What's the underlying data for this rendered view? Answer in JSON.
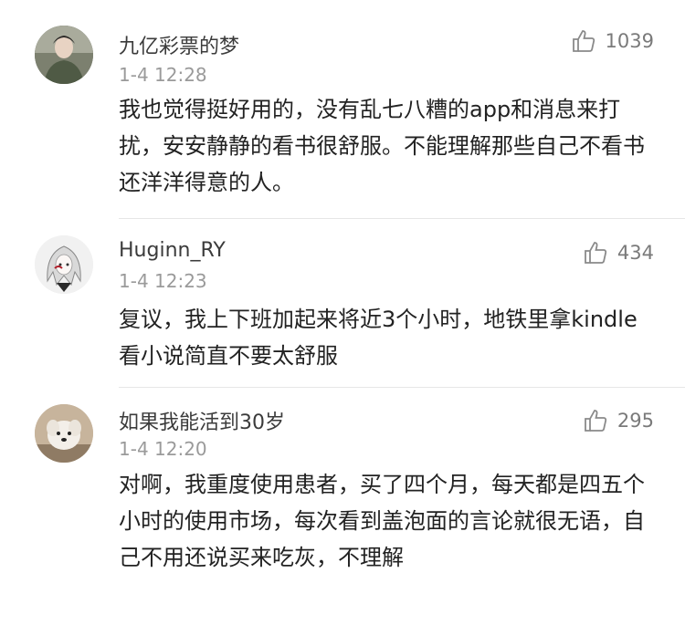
{
  "comments": [
    {
      "username": "九亿彩票的梦",
      "time": "1-4 12:28",
      "likes": "1039",
      "text": "我也觉得挺好用的，没有乱七八糟的app和消息来打扰，安安静静的看书很舒服。不能理解那些自己不看书还洋洋得意的人。",
      "avatar_icon": "avatar-man-photo"
    },
    {
      "username": "Huginn_RY",
      "time": "1-4 12:23",
      "likes": "434",
      "text": "复议，我上下班加起来将近3个小时，地铁里拿kindle看小说简直不要太舒服",
      "avatar_icon": "avatar-anime-drawing"
    },
    {
      "username": "如果我能活到30岁",
      "time": "1-4 12:20",
      "likes": "295",
      "text": "对啊，我重度使用患者，买了四个月，每天都是四五个小时的使用市场，每次看到盖泡面的言论就很无语，自己不用还说买来吃灰，不理解",
      "avatar_icon": "avatar-dog-photo"
    }
  ],
  "icons": {
    "like": "thumbs-up-icon"
  }
}
